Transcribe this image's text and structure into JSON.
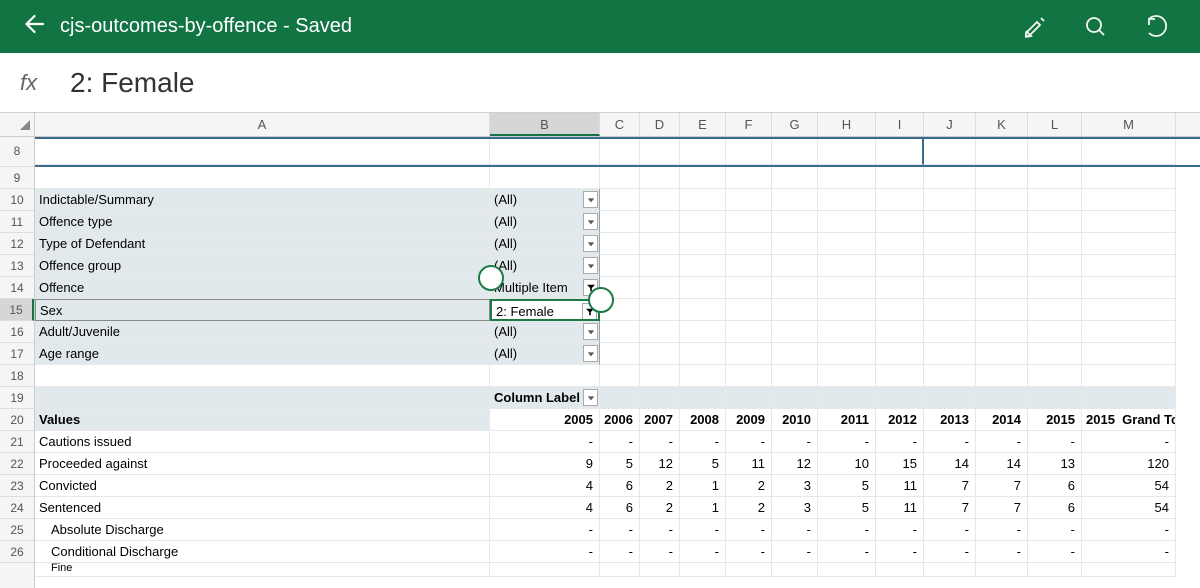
{
  "header": {
    "title": "cjs-outcomes-by-offence - Saved"
  },
  "formula": {
    "symbol": "fx",
    "value": "2: Female"
  },
  "columns": [
    "A",
    "B",
    "C",
    "D",
    "E",
    "F",
    "G",
    "H",
    "I",
    "J",
    "K",
    "L",
    "M"
  ],
  "rowNumbers": [
    "8",
    "9",
    "10",
    "11",
    "12",
    "13",
    "14",
    "15",
    "16",
    "17",
    "18",
    "19",
    "20",
    "21",
    "22",
    "23",
    "24",
    "25",
    "26"
  ],
  "filters": [
    {
      "label": "Indictable/Summary",
      "value": "(All)",
      "filtered": false
    },
    {
      "label": "Offence type",
      "value": "(All)",
      "filtered": false
    },
    {
      "label": "Type of Defendant",
      "value": "(All)",
      "filtered": false
    },
    {
      "label": "Offence group",
      "value": "(All)",
      "filtered": false
    },
    {
      "label": "Offence",
      "value": "Multiple Item",
      "filtered": true
    },
    {
      "label": "Sex",
      "value": "2: Female",
      "filtered": true
    },
    {
      "label": "Adult/Juvenile",
      "value": "(All)",
      "filtered": false
    },
    {
      "label": "Age range",
      "value": "(All)",
      "filtered": false
    }
  ],
  "pivot": {
    "columnLabelHeader": "Column Label",
    "valuesHeader": "Values",
    "grandTotal": "Grand Total",
    "years": [
      "2005",
      "2006",
      "2007",
      "2008",
      "2009",
      "2010",
      "2011",
      "2012",
      "2013",
      "2014",
      "2015"
    ],
    "rows": [
      {
        "label": "Cautions issued",
        "v": [
          "-",
          "-",
          "-",
          "-",
          "-",
          "-",
          "-",
          "-",
          "-",
          "-",
          "-",
          "-"
        ],
        "indent": false
      },
      {
        "label": "Proceeded against",
        "v": [
          "9",
          "5",
          "12",
          "5",
          "11",
          "12",
          "10",
          "15",
          "14",
          "14",
          "13",
          "120"
        ],
        "indent": false
      },
      {
        "label": "Convicted",
        "v": [
          "4",
          "6",
          "2",
          "1",
          "2",
          "3",
          "5",
          "11",
          "7",
          "7",
          "6",
          "54"
        ],
        "indent": false
      },
      {
        "label": "Sentenced",
        "v": [
          "4",
          "6",
          "2",
          "1",
          "2",
          "3",
          "5",
          "11",
          "7",
          "7",
          "6",
          "54"
        ],
        "indent": false
      },
      {
        "label": "Absolute Discharge",
        "v": [
          "-",
          "-",
          "-",
          "-",
          "-",
          "-",
          "-",
          "-",
          "-",
          "-",
          "-",
          "-"
        ],
        "indent": true
      },
      {
        "label": "Conditional Discharge",
        "v": [
          "-",
          "-",
          "-",
          "-",
          "-",
          "-",
          "-",
          "-",
          "-",
          "-",
          "-",
          "-"
        ],
        "indent": true
      },
      {
        "label": "Fine",
        "v": [
          "",
          "",
          "",
          "",
          "",
          "",
          "",
          "",
          "",
          "",
          "",
          ""
        ],
        "indent": true
      }
    ]
  }
}
